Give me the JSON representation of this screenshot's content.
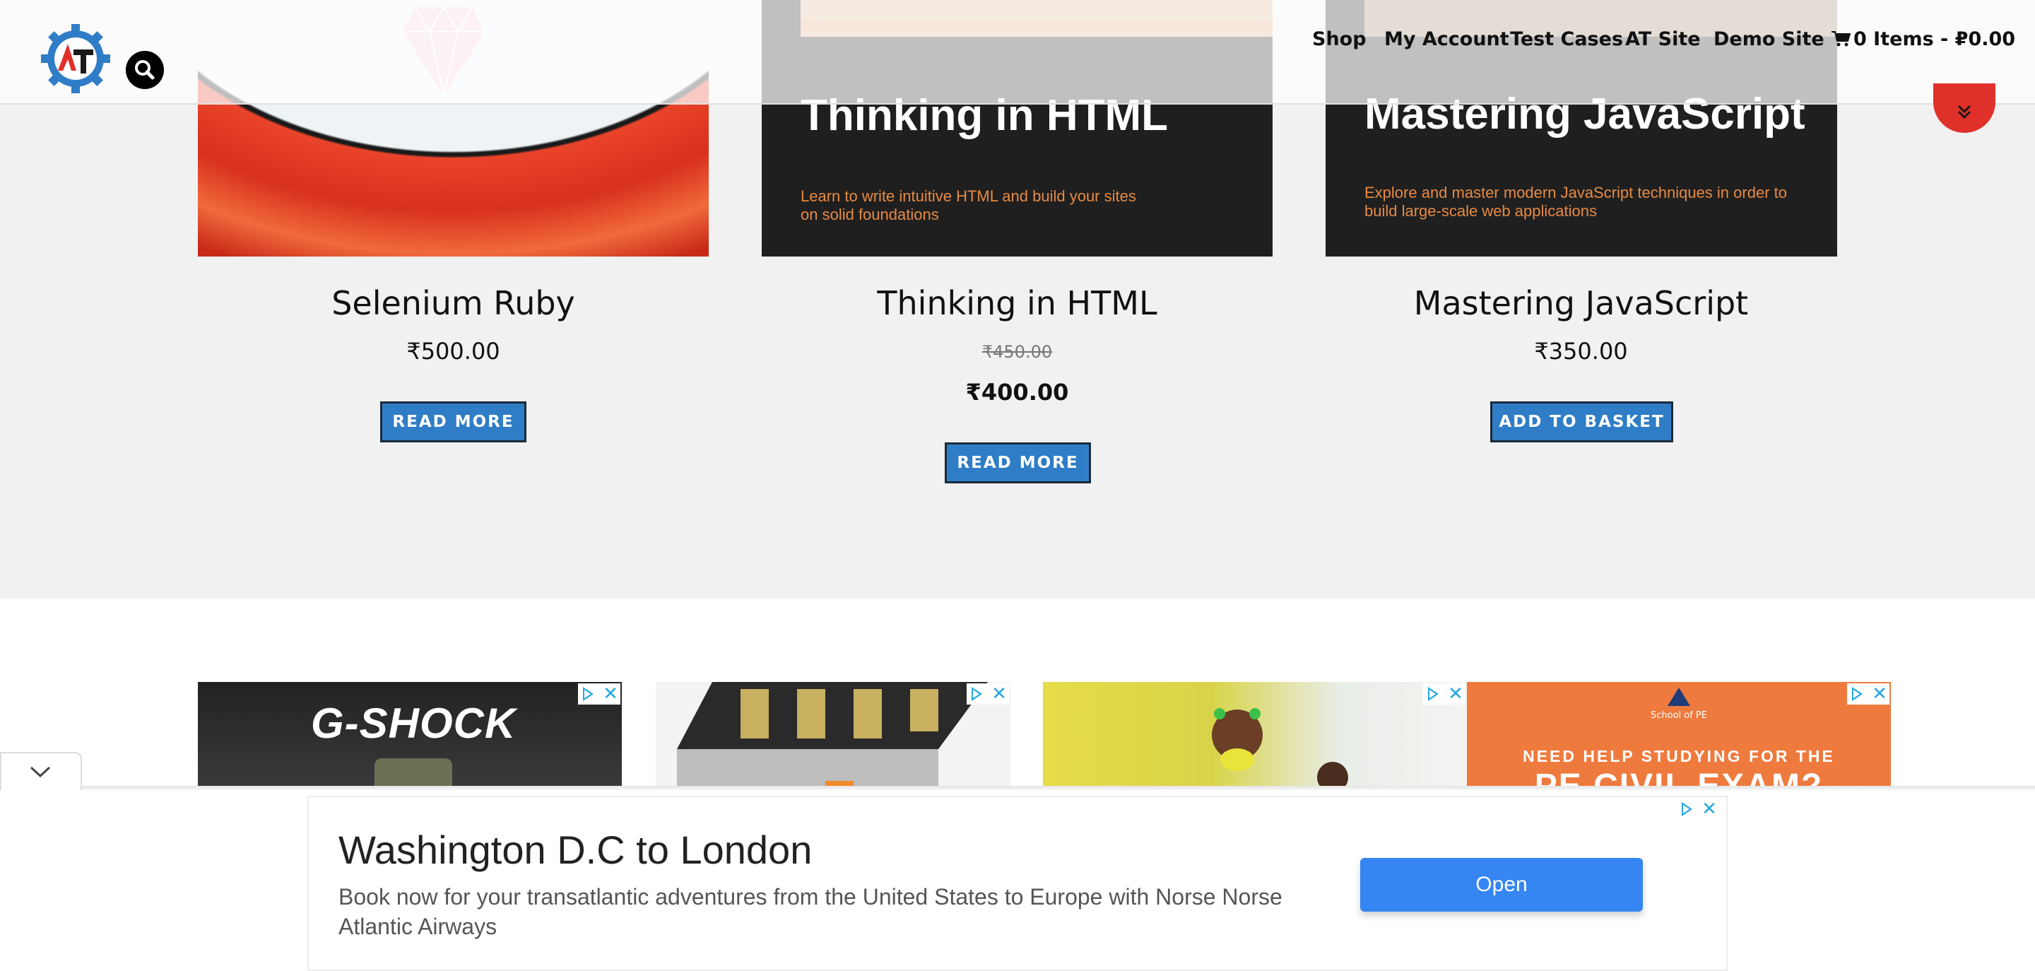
{
  "header": {
    "nav": [
      "Shop",
      "My Account",
      "Test Cases",
      "AT Site",
      "Demo Site"
    ],
    "cart": "0 Items - ₽0.00"
  },
  "products": [
    {
      "title": "Selenium Ruby",
      "price": "₹500.00",
      "button": "READ MORE"
    },
    {
      "title": "Thinking in HTML",
      "price_old": "₹450.00",
      "price": "₹400.00",
      "button": "READ MORE",
      "cover_title": "Thinking in HTML",
      "cover_sub": "Learn to write intuitive HTML and build your sites\non solid foundations"
    },
    {
      "title": "Mastering JavaScript",
      "price": "₹350.00",
      "button": "ADD TO BASKET",
      "cover_title": "Mastering JavaScript",
      "cover_sub": "Explore and master modern JavaScript techniques in order to\nbuild large-scale web applications"
    }
  ],
  "ads": {
    "gshock": "G-SHOCK",
    "pe_school": "School of PE",
    "pe_line1": "NEED HELP STUDYING FOR THE",
    "pe_line2": "PE CIVIL EXAM?"
  },
  "anchor_ad": {
    "title": "Washington D.C to London",
    "text": "Book now for your transatlantic adventures from the United States to Europe with Norse Norse Atlantic Airways",
    "button": "Open"
  },
  "colors": {
    "button_blue": "#2f7dc6",
    "accent_red": "#e0302a",
    "logo_blue": "#2f7dc6",
    "ad_blue": "#3585f2"
  }
}
